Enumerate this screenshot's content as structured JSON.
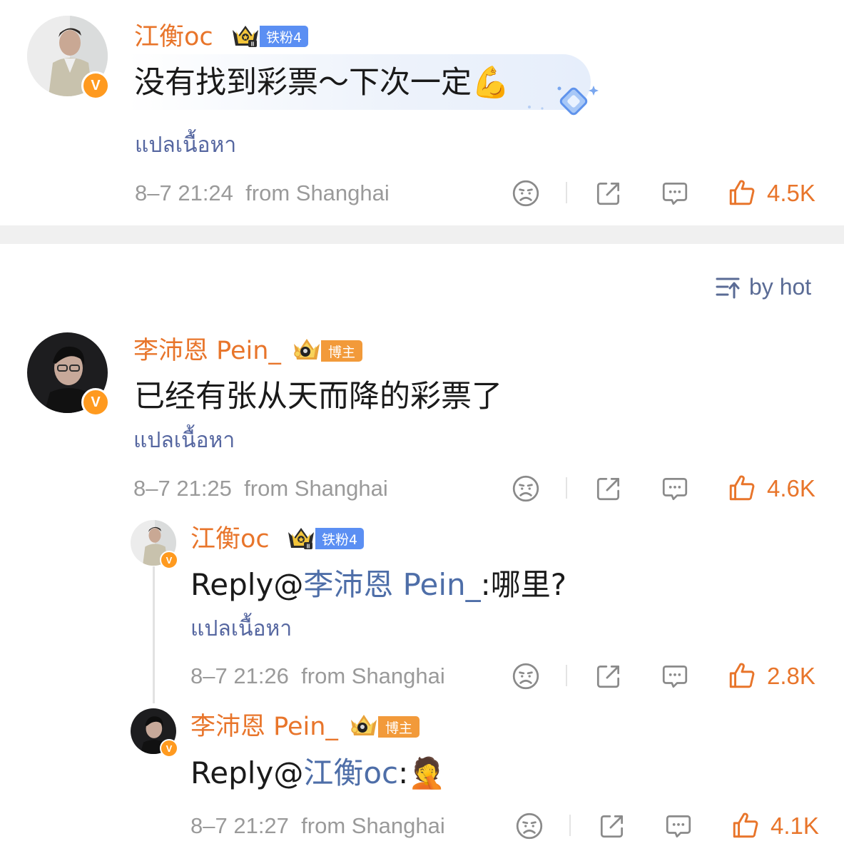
{
  "comments": [
    {
      "username": "江衡oc",
      "fan_badge": "铁粉4",
      "text": "没有找到彩票～下次一定💪",
      "translate": "แปลเนื้อหา",
      "time": "8–7 21:24",
      "location": "from Shanghai",
      "likes": "4.5K"
    }
  ],
  "sort_label": "by hot",
  "reply_thread": {
    "parent": {
      "username": "李沛恩 Pein_",
      "fan_badge": "博主",
      "text": "已经有张从天而降的彩票了",
      "translate": "แปลเนื้อหา",
      "time": "8–7 21:25",
      "location": "from Shanghai",
      "likes": "4.6K"
    },
    "replies": [
      {
        "username": "江衡oc",
        "fan_badge": "铁粉4",
        "reply_prefix": "Reply@",
        "mention": "李沛恩 Pein_",
        "text_after": ":哪里?",
        "translate": "แปลเนื้อหา",
        "time": "8–7 21:26",
        "location": "from Shanghai",
        "likes": "2.8K"
      },
      {
        "username": "李沛恩 Pein_",
        "fan_badge": "博主",
        "reply_prefix": "Reply@",
        "mention": "江衡oc",
        "text_after": ":🤦",
        "time": "8–7 21:27",
        "location": "from Shanghai",
        "likes": "4.1K"
      }
    ]
  },
  "icons": [
    "verified-v-icon",
    "crown-icon",
    "sad-face-icon",
    "share-icon",
    "comment-icon",
    "thumbs-up-icon",
    "sort-icon"
  ],
  "colors": {
    "username": "#e8752b",
    "mention": "#4e6ea8",
    "translate": "#5566a0",
    "meta": "#9a9a9a",
    "likes": "#e8752b"
  }
}
